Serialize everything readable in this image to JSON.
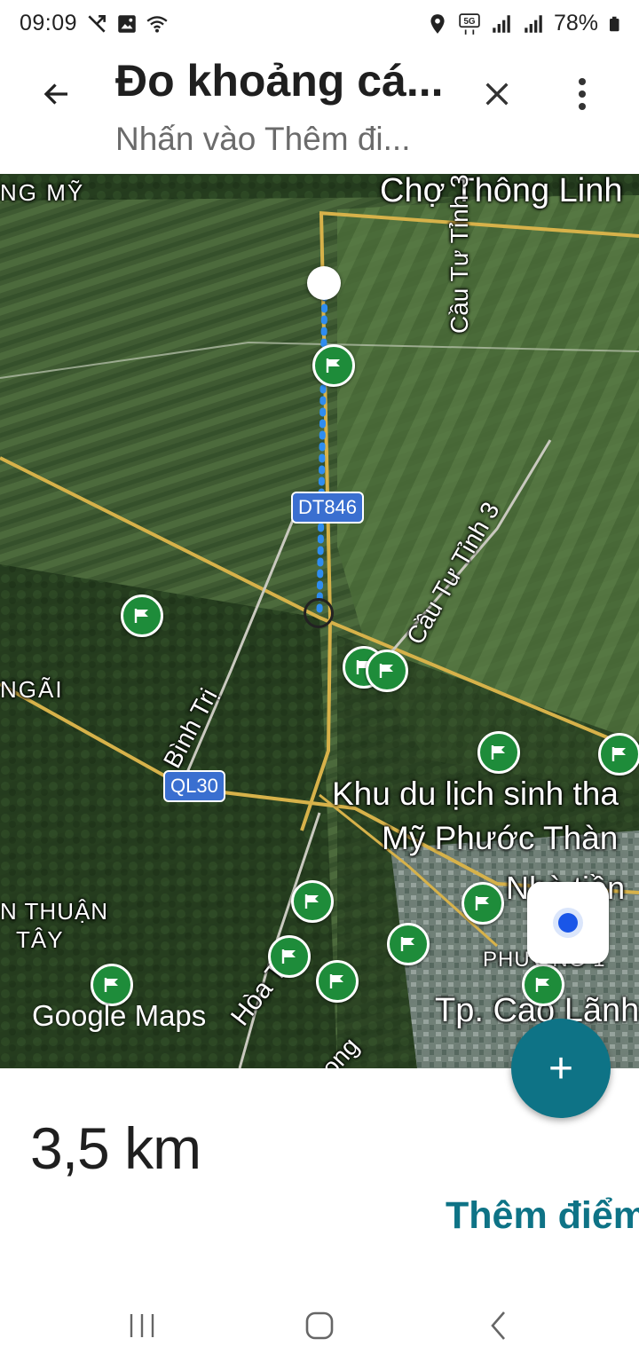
{
  "status_bar": {
    "time": "09:09",
    "battery": "78%"
  },
  "header": {
    "title": "Đo khoảng cá...",
    "subtitle": "Nhấn vào Thêm đi..."
  },
  "map": {
    "labels": {
      "place_top_left": "NG MỸ",
      "place_top_right": "Chợ Thông Linh",
      "road_right": "Cầu Tư Tỉnh 3",
      "road_middle": "Cầu Tư Tỉnh 3",
      "place_left": "NGÃI",
      "road_binh_tri": "Bình Trị",
      "poi_line1": "Khu du lịch sinh tha",
      "poi_line2": "Mỹ Phước Thàn",
      "place_bottom_left1": "N THUẬN",
      "place_bottom_left2": "TÂY",
      "road_hoa_tay": "Hòa Tây",
      "ward": "PHƯỜNG 1",
      "city": "Tp. Cao Lãnh",
      "poi_partial": "Nhà tiền",
      "road_bottom": "ong"
    },
    "shields": {
      "dt846": "DT846",
      "ql30": "QL30"
    },
    "logo": "Google Maps"
  },
  "distance": "3,5 km",
  "add_point": "Thêm điểm",
  "fab_label": "+",
  "colors": {
    "accent": "#0e7386",
    "flag": "#1e8c3a",
    "route": "#2f8df0"
  }
}
